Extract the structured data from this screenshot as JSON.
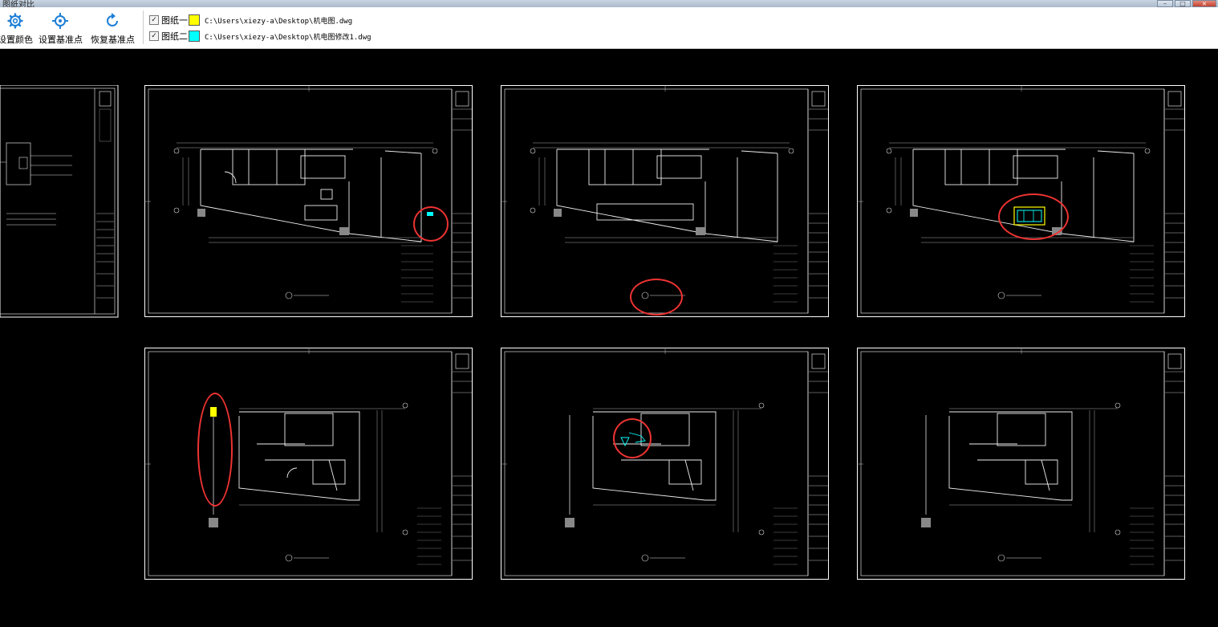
{
  "window": {
    "title": "图纸对比"
  },
  "toolbar": {
    "set_color_label": "设置颜色",
    "set_base_point_label": "设置基准点",
    "restore_base_point_label": "恢复基准点"
  },
  "drawings": [
    {
      "checked": true,
      "label": "图纸一",
      "color": "#ffff00",
      "path": "C:\\Users\\xiezy-a\\Desktop\\机电图.dwg"
    },
    {
      "checked": true,
      "label": "图纸二",
      "color": "#00ffff",
      "path": "C:\\Users\\xiezy-a\\Desktop\\机电图修改1.dwg"
    }
  ],
  "colors": {
    "background": "#000000",
    "linework": "#ffffff",
    "highlight_ring": "#e33333",
    "diff_one": "#ffff00",
    "diff_two": "#00ffff"
  },
  "sheet_count": 7
}
